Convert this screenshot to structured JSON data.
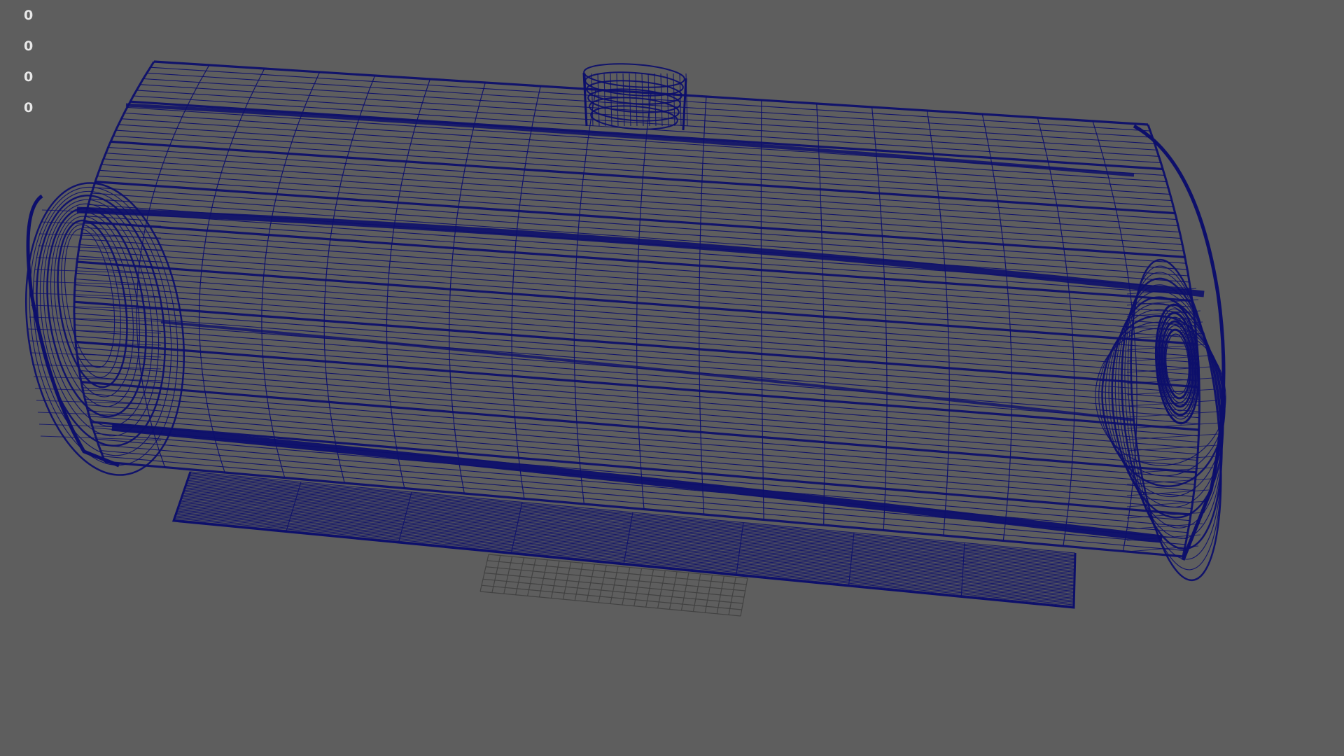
{
  "viewport": {
    "background": "#5e5e5e",
    "wire_color": "#0d0f6b",
    "grid_color": "#3f3f3f",
    "hud_text_color": "#e8e8e8"
  },
  "hud": {
    "stats": [
      "0",
      "0",
      "0",
      "0"
    ]
  }
}
